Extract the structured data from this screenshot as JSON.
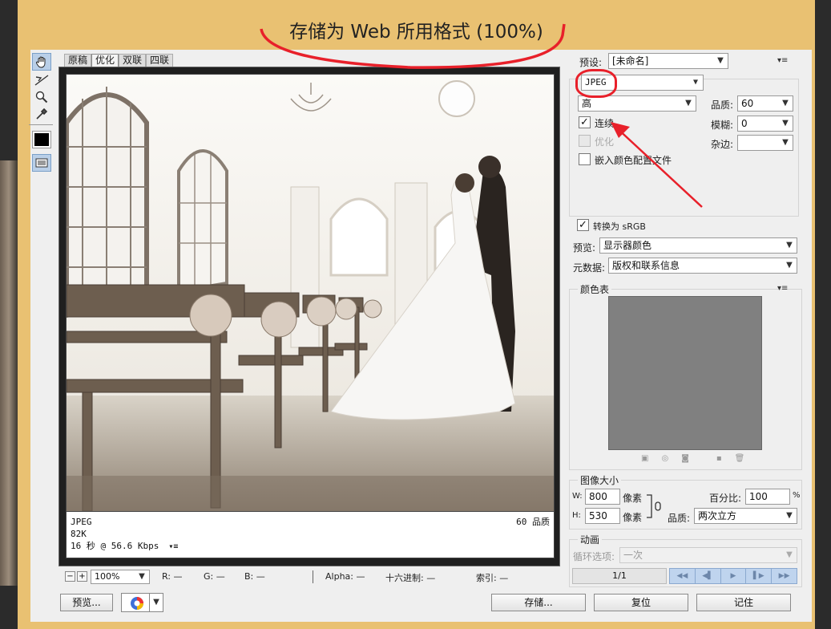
{
  "title": "存储为 Web 所用格式 (100%)",
  "tabs": [
    "原稿",
    "优化",
    "双联",
    "四联"
  ],
  "tools": {
    "hand": "hand-icon",
    "slice_select": "slice-select-icon",
    "zoom": "zoom-icon",
    "eyedropper": "eyedropper-icon"
  },
  "info": {
    "format": "JPEG",
    "size": "82K",
    "speed": "16 秒 @ 56.6 Kbps",
    "menu": "▾≡",
    "quality": "60 品质"
  },
  "status": {
    "zoom": "100%",
    "r": "R: —",
    "g": "G: —",
    "b": "B: —",
    "alpha": "Alpha: —",
    "hex": "十六进制: —",
    "index": "索引: —"
  },
  "settings": {
    "preset_label": "预设:",
    "preset_value": "[未命名]",
    "format_value": "JPEG",
    "quality_level": "高",
    "quality_label": "品质:",
    "quality_value": "60",
    "progressive_label": "连续",
    "blur_label": "模糊:",
    "blur_value": "0",
    "optimized_label": "优化",
    "matte_label": "杂边:",
    "matte_value": "",
    "embed_profile_label": "嵌入颜色配置文件",
    "convert_srgb_label": "转换为 sRGB",
    "preview_label": "预览:",
    "preview_value": "显示器颜色",
    "metadata_label": "元数据:",
    "metadata_value": "版权和联系信息",
    "colortable_label": "颜色表"
  },
  "image_size": {
    "section_label": "图像大小",
    "w_label": "W:",
    "w_value": "800",
    "w_unit": "像素",
    "h_label": "H:",
    "h_value": "530",
    "h_unit": "像素",
    "percent_label": "百分比:",
    "percent_value": "100",
    "percent_unit": "%",
    "quality_label": "品质:",
    "quality_value": "两次立方"
  },
  "animation": {
    "section_label": "动画",
    "loop_label": "循环选项:",
    "loop_value": "一次",
    "frame": "1/1"
  },
  "buttons": {
    "preview": "预览...",
    "save": "存储...",
    "reset": "复位",
    "remember": "记住"
  },
  "colors": {
    "dialog_bg": "#e9c172",
    "panel_bg": "#efefef",
    "annotation": "#e8202a",
    "color_table": "#808080"
  }
}
